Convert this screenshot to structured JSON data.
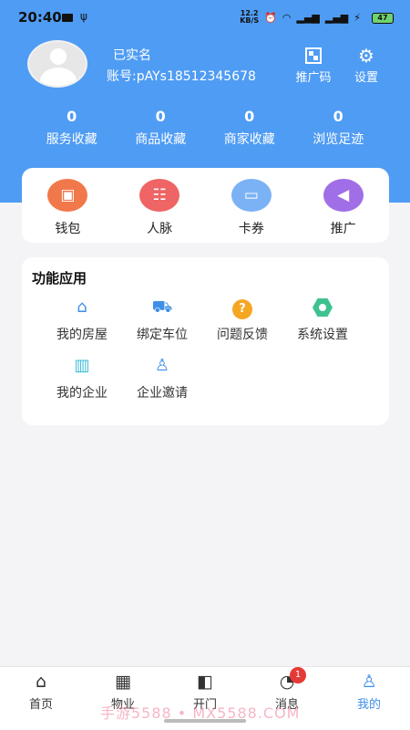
{
  "status_bar": {
    "time": "20:40",
    "speed": "12.2",
    "speed_unit": "KB/S",
    "battery": "47"
  },
  "profile": {
    "verified": "已实名",
    "account": "账号:pAYs18512345678",
    "promo_code_label": "推广码",
    "settings_label": "设置"
  },
  "stats": [
    {
      "value": "0",
      "label": "服务收藏"
    },
    {
      "value": "0",
      "label": "商品收藏"
    },
    {
      "value": "0",
      "label": "商家收藏"
    },
    {
      "value": "0",
      "label": "浏览足迹"
    }
  ],
  "wallet": [
    {
      "label": "钱包",
      "icon": "wallet-icon",
      "color": "#f1784a"
    },
    {
      "label": "人脉",
      "icon": "contacts-icon",
      "color": "#ef6464"
    },
    {
      "label": "卡券",
      "icon": "card-icon",
      "color": "#7bb2f5"
    },
    {
      "label": "推广",
      "icon": "megaphone-icon",
      "color": "#a06ee6"
    }
  ],
  "functions": {
    "title": "功能应用",
    "items": [
      {
        "label": "我的房屋",
        "icon": "house-icon"
      },
      {
        "label": "绑定车位",
        "icon": "car-icon"
      },
      {
        "label": "问题反馈",
        "icon": "question-icon"
      },
      {
        "label": "系统设置",
        "icon": "settings-hex-icon"
      },
      {
        "label": "我的企业",
        "icon": "building-icon"
      },
      {
        "label": "企业邀请",
        "icon": "invite-icon"
      }
    ]
  },
  "bottom_nav": [
    {
      "label": "首页",
      "icon": "home-icon"
    },
    {
      "label": "物业",
      "icon": "property-icon"
    },
    {
      "label": "开门",
      "icon": "door-icon"
    },
    {
      "label": "消息",
      "icon": "message-icon",
      "badge": "1"
    },
    {
      "label": "我的",
      "icon": "profile-icon",
      "active": true
    }
  ],
  "watermark": "手游5588 • MX5588.COM",
  "colors": {
    "header_blue": "#4f9cf4",
    "active_blue": "#3e8fe8",
    "badge_red": "#e53935"
  }
}
